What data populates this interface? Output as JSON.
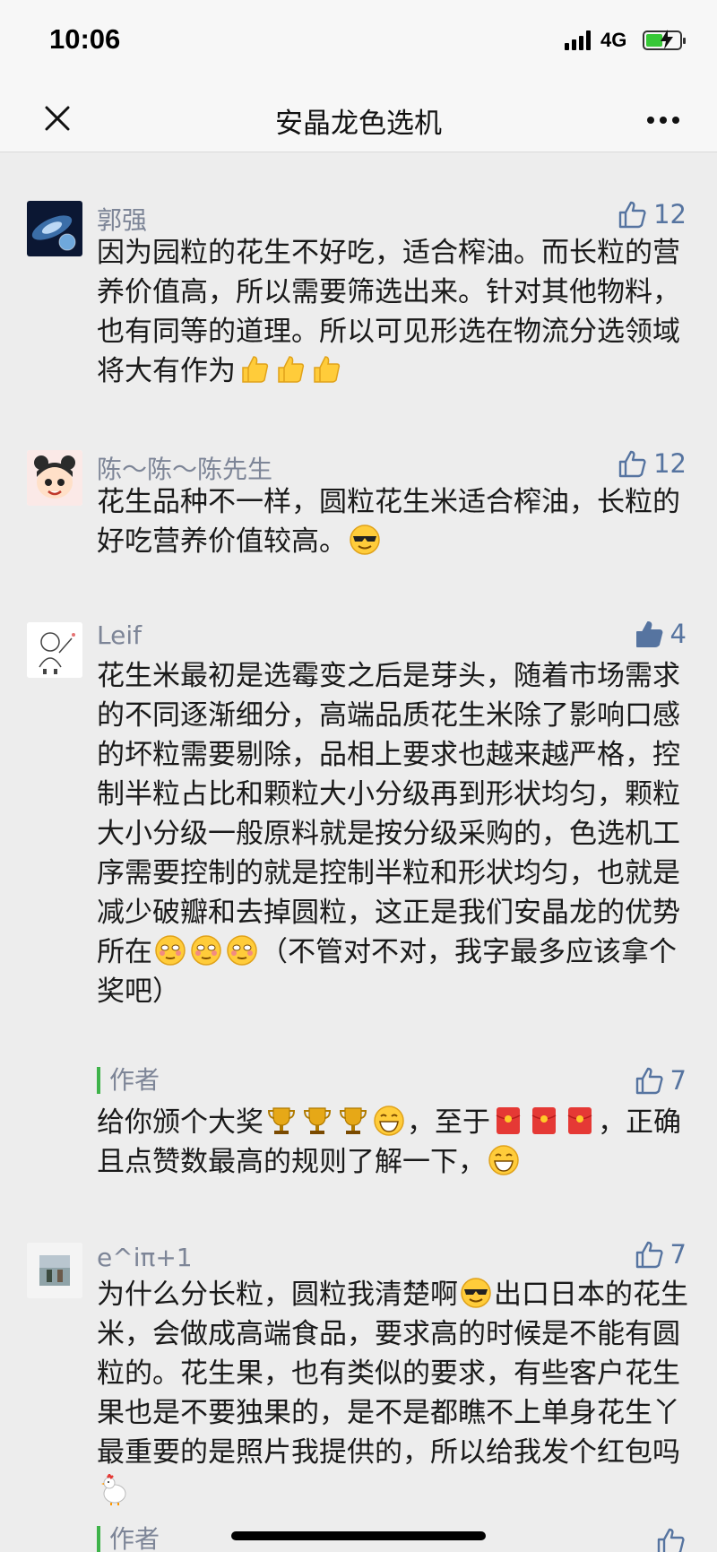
{
  "status": {
    "time": "10:06",
    "network": "4G"
  },
  "nav": {
    "title": "安晶龙色选机"
  },
  "comments": [
    {
      "author": "郭强",
      "likes": "12",
      "text": "因为园粒的花生不好吃，适合榨油。而长粒的营养价值高，所以需要筛选出来。针对其他物料，也有同等的道理。所以可见形选在物流分选领域将大有作为"
    },
    {
      "author": "陈～陈～陈先生",
      "likes": "12",
      "text": "花生品种不一样，圆粒花生米适合榨油，长粒的好吃营养价值较高。"
    },
    {
      "author": "Leif",
      "likes": "4",
      "text": "花生米最初是选霉变之后是芽头，随着市场需求的不同逐渐细分，高端品质花生米除了影响口感的坏粒需要剔除，品相上要求也越来越严格，控制半粒占比和颗粒大小分级再到形状均匀，颗粒大小分级一般原料就是按分级采购的，色选机工序需要控制的就是控制半粒和形状均匀，也就是减少破瓣和去掉圆粒，这正是我们安晶龙的优势所在",
      "text_tail": "（不管对不对，我字最多应该拿个奖吧）",
      "reply": {
        "author": "作者",
        "likes": "7",
        "text_a": "给你颁个大奖",
        "text_b": "，至于",
        "text_c": "，正确且点赞数最高的规则了解一下，"
      }
    },
    {
      "author": "e^iπ+1",
      "likes": "7",
      "text_a": "为什么分长粒，圆粒我清楚啊",
      "text_b": "出口日本的花生米，会做成高端食品，要求高的时候是不能有圆粒的。花生果，也有类似的要求，有些客户花生果也是不要独果的，是不是都瞧不上单身花生丫最重要的是照片我提供的，所以给我发个红包吗",
      "reply": {
        "author": "作者"
      }
    }
  ],
  "icons": [
    "close-icon",
    "more-icon",
    "thumbs-up-icon",
    "signal-icon",
    "battery-icon"
  ],
  "colors": {
    "name": "#7d8597",
    "like": "#5674a0",
    "reply_bar": "#3eb34a",
    "battery": "#37c837"
  }
}
